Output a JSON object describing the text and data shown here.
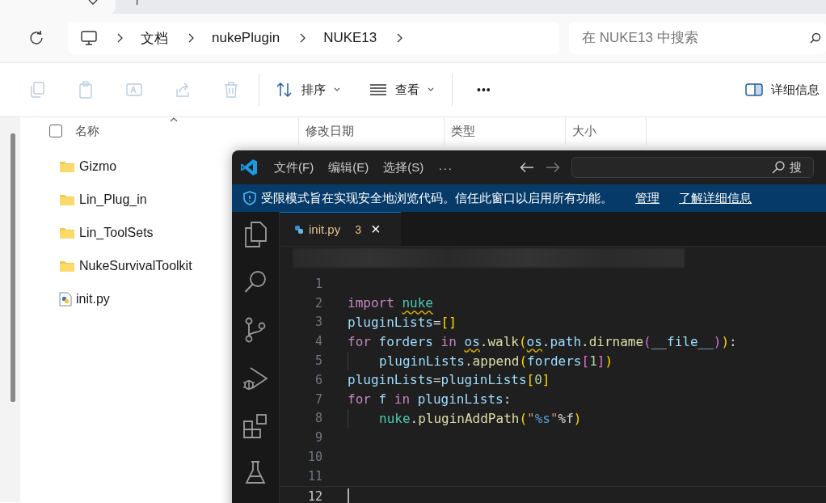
{
  "explorer": {
    "address": {
      "crumbs": [
        "文档",
        "nukePlugin",
        "NUKE13"
      ]
    },
    "search": {
      "placeholder": "在 NUKE13 中搜索"
    },
    "toolbar": {
      "icon_buttons": [
        {
          "kind": "copy",
          "disabled": true
        },
        {
          "kind": "paste",
          "disabled": true
        },
        {
          "kind": "rename",
          "disabled": true
        },
        {
          "kind": "share",
          "disabled": true
        },
        {
          "kind": "delete",
          "disabled": true
        }
      ],
      "sort": {
        "label": "排序"
      },
      "view": {
        "label": "查看"
      },
      "more": "•••",
      "details": {
        "label": "详细信息"
      }
    },
    "select_all": {
      "checked": false
    },
    "columns": [
      "名称",
      "修改日期",
      "类型",
      "大小"
    ],
    "files": [
      {
        "name": "Gizmo",
        "kind": "folder"
      },
      {
        "name": "Lin_Plug_in",
        "kind": "folder"
      },
      {
        "name": "Lin_ToolSets",
        "kind": "folder"
      },
      {
        "name": "NukeSurvivalToolkit",
        "kind": "folder"
      },
      {
        "name": "init.py",
        "kind": "python"
      }
    ]
  },
  "editor": {
    "menu": [
      "文件(F)",
      "编辑(E)",
      "选择(S)"
    ],
    "more": "···",
    "search_label": "搜",
    "banner": {
      "message": "受限模式旨在实现安全地浏览代码。信任此窗口以启用所有功能。",
      "links": [
        "管理",
        "了解详细信息"
      ]
    },
    "tab": {
      "name": "init.py",
      "problems": "3",
      "close": "×"
    },
    "lines": [
      {
        "number": "1",
        "indented": false,
        "current": false
      },
      {
        "number": "2",
        "indented": false,
        "current": false,
        "tokens": [
          {
            "text": "import ",
            "kind": "keyword",
            "warning": false
          },
          {
            "text": "nuke",
            "kind": "module",
            "warning": true
          }
        ]
      },
      {
        "number": "3",
        "indented": false,
        "current": false,
        "tokens": [
          {
            "text": "pluginLists",
            "kind": "variable",
            "warning": false
          },
          {
            "text": "=",
            "kind": "plain",
            "warning": false
          },
          {
            "text": "[]",
            "kind": "bracket1",
            "warning": false
          }
        ]
      },
      {
        "number": "4",
        "indented": false,
        "current": false,
        "tokens": [
          {
            "text": "for ",
            "kind": "keyword",
            "warning": false
          },
          {
            "text": "forders ",
            "kind": "variable",
            "warning": false
          },
          {
            "text": "in ",
            "kind": "keyword",
            "warning": false
          },
          {
            "text": "os",
            "kind": "variable",
            "warning": true
          },
          {
            "text": ".",
            "kind": "plain",
            "warning": false
          },
          {
            "text": "walk",
            "kind": "function",
            "warning": false
          },
          {
            "text": "(",
            "kind": "bracket1",
            "warning": false
          },
          {
            "text": "os",
            "kind": "variable",
            "warning": true
          },
          {
            "text": ".",
            "kind": "plain",
            "warning": false
          },
          {
            "text": "path",
            "kind": "variable",
            "warning": false
          },
          {
            "text": ".",
            "kind": "plain",
            "warning": false
          },
          {
            "text": "dirname",
            "kind": "function",
            "warning": false
          },
          {
            "text": "(",
            "kind": "bracket2",
            "warning": false
          },
          {
            "text": "__file__",
            "kind": "variable",
            "warning": false
          },
          {
            "text": ")",
            "kind": "bracket2",
            "warning": false
          },
          {
            "text": ")",
            "kind": "bracket1",
            "warning": false
          },
          {
            "text": ":",
            "kind": "plain",
            "warning": false
          }
        ]
      },
      {
        "number": "5",
        "indented": true,
        "current": false,
        "tokens": [
          {
            "text": "pluginLists",
            "kind": "variable",
            "warning": false
          },
          {
            "text": ".",
            "kind": "plain",
            "warning": false
          },
          {
            "text": "append",
            "kind": "function",
            "warning": false
          },
          {
            "text": "(",
            "kind": "bracket1",
            "warning": false
          },
          {
            "text": "forders",
            "kind": "variable",
            "warning": false
          },
          {
            "text": "[",
            "kind": "bracket2",
            "warning": false
          },
          {
            "text": "1",
            "kind": "number",
            "warning": false
          },
          {
            "text": "]",
            "kind": "bracket2",
            "warning": false
          },
          {
            "text": ")",
            "kind": "bracket1",
            "warning": false
          }
        ]
      },
      {
        "number": "6",
        "indented": false,
        "current": false,
        "tokens": [
          {
            "text": "pluginLists",
            "kind": "variable",
            "warning": false
          },
          {
            "text": "=",
            "kind": "plain",
            "warning": false
          },
          {
            "text": "pluginLists",
            "kind": "variable",
            "warning": false
          },
          {
            "text": "[",
            "kind": "bracket1",
            "warning": false
          },
          {
            "text": "0",
            "kind": "number",
            "warning": false
          },
          {
            "text": "]",
            "kind": "bracket1",
            "warning": false
          }
        ]
      },
      {
        "number": "7",
        "indented": false,
        "current": false,
        "tokens": [
          {
            "text": "for ",
            "kind": "keyword",
            "warning": false
          },
          {
            "text": "f ",
            "kind": "variable",
            "warning": false
          },
          {
            "text": "in ",
            "kind": "keyword",
            "warning": false
          },
          {
            "text": "pluginLists",
            "kind": "variable",
            "warning": false
          },
          {
            "text": ":",
            "kind": "plain",
            "warning": false
          }
        ]
      },
      {
        "number": "8",
        "indented": true,
        "current": false,
        "tokens": [
          {
            "text": "nuke",
            "kind": "module",
            "warning": false
          },
          {
            "text": ".",
            "kind": "plain",
            "warning": false
          },
          {
            "text": "pluginAddPath",
            "kind": "function",
            "warning": false
          },
          {
            "text": "(",
            "kind": "bracket1",
            "warning": false
          },
          {
            "text": "\"",
            "kind": "string",
            "warning": false
          },
          {
            "text": "%s",
            "kind": "format",
            "warning": false
          },
          {
            "text": "\"",
            "kind": "string",
            "warning": false
          },
          {
            "text": "%f",
            "kind": "plain",
            "warning": false
          },
          {
            "text": ")",
            "kind": "bracket1",
            "warning": false
          }
        ]
      },
      {
        "number": "9",
        "indented": false,
        "current": false
      },
      {
        "number": "10",
        "indented": false,
        "current": false
      },
      {
        "number": "11",
        "indented": false,
        "current": false
      },
      {
        "number": "12",
        "indented": false,
        "current": true
      }
    ]
  }
}
